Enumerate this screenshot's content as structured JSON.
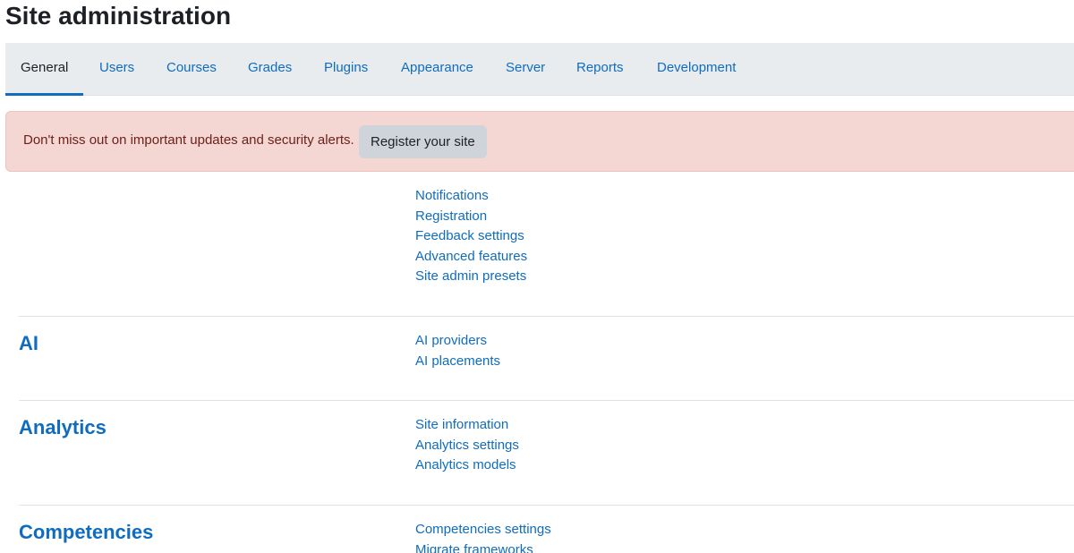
{
  "page": {
    "title": "Site administration"
  },
  "tabs": [
    {
      "label": "General",
      "active": true
    },
    {
      "label": "Users",
      "active": false
    },
    {
      "label": "Courses",
      "active": false
    },
    {
      "label": "Grades",
      "active": false
    },
    {
      "label": "Plugins",
      "active": false
    },
    {
      "label": "Appearance",
      "active": false
    },
    {
      "label": "Server",
      "active": false
    },
    {
      "label": "Reports",
      "active": false
    },
    {
      "label": "Development",
      "active": false
    }
  ],
  "alert": {
    "message": "Don't miss out on important updates and security alerts.",
    "button_label": "Register your site"
  },
  "sections": [
    {
      "heading": "",
      "links": [
        "Notifications",
        "Registration",
        "Feedback settings",
        "Advanced features",
        "Site admin presets"
      ]
    },
    {
      "heading": "AI",
      "links": [
        "AI providers",
        "AI placements"
      ]
    },
    {
      "heading": "Analytics",
      "links": [
        "Site information",
        "Analytics settings",
        "Analytics models"
      ]
    },
    {
      "heading": "Competencies",
      "links": [
        "Competencies settings",
        "Migrate frameworks"
      ]
    }
  ],
  "colors": {
    "link": "#0f6cbf",
    "tabbar_bg": "#e9ecef",
    "alert_bg": "#f4d6d2",
    "alert_text": "#6e211a",
    "button_bg": "#ced4da"
  }
}
